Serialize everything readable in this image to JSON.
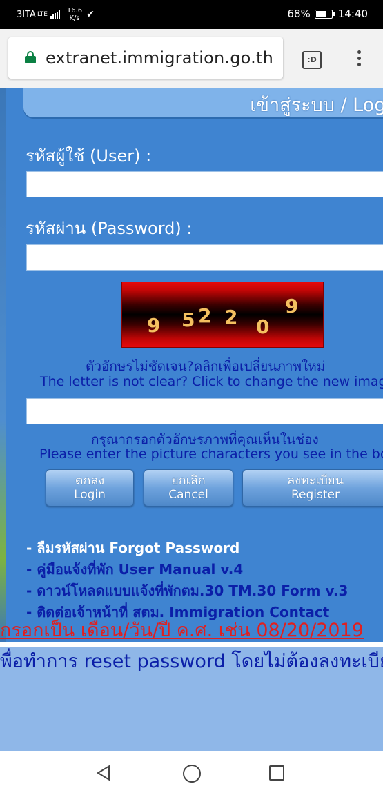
{
  "status_bar": {
    "carrier": "3ITA",
    "network": "LTE",
    "speed_value": "16.6",
    "speed_unit": "K/s",
    "battery": "68%",
    "battery_level": 0.68,
    "time": "14:40"
  },
  "browser": {
    "url": "extranet.immigration.go.th",
    "tabs_label": ":D"
  },
  "header": {
    "title": "เข้าสู่ระบบ / Login"
  },
  "form": {
    "user_label": "รหัสผู้ใช้ (User) :",
    "user_value": "",
    "password_label": "รหัสผ่าน (Password) :",
    "password_value": "",
    "captcha_digits": [
      "9",
      "5",
      "2",
      "2",
      "0",
      "9"
    ],
    "captcha_hint_th": "ตัวอักษรไม่ชัดเจน?คลิกเพื่อเปลี่ยนภาพใหม่",
    "captcha_hint_en": "The letter is not clear? Click to change the new image",
    "captcha_value": "",
    "enter_hint_th": "กรุณากรอกตัวอักษรภาพที่คุณเห็นในช่อง",
    "enter_hint_en": "Please enter the picture characters you see in the box"
  },
  "buttons": {
    "login_th": "ตกลง",
    "login_en": "Login",
    "cancel_th": "ยกเลิก",
    "cancel_en": "Cancel",
    "register_th": "ลงทะเบียน",
    "register_en": "Register"
  },
  "links": [
    "- ลืมรหัสผ่าน Forgot Password",
    "- คู่มือแจ้งที่พัก User Manual v.4",
    "- ดาวน์โหลดแบบแจ้งที่พักตม.30 TM.30 Form v.3",
    "- ติดต่อเจ้าหน้าที่ สตม. Immigration Contact"
  ],
  "notice": {
    "red_text": "กรอกเป็น เดือน/วัน/ปี ค.ศ. เช่น 08/20/2019",
    "blue_text": "พื่อทำการ reset password โดยไม่ต้องลงทะเบียน"
  },
  "colors": {
    "panel": "#3f84d1",
    "title_bar": "#7fb3ea",
    "hint_text": "#0b1fa8",
    "notice_red": "#e02020"
  }
}
